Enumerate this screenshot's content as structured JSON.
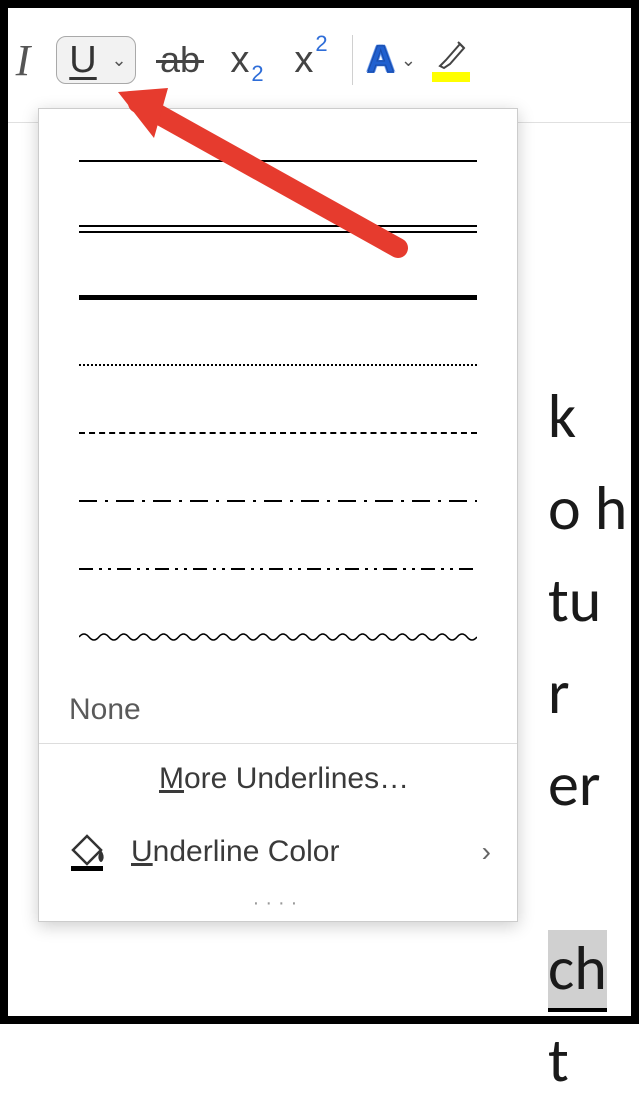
{
  "toolbar": {
    "italic_label": "I",
    "underline_label": "U",
    "strike_label": "ab",
    "subscript_x": "x",
    "subscript_n": "2",
    "superscript_x": "x",
    "superscript_n": "2",
    "font_color_label": "A"
  },
  "dropdown": {
    "none_label": "None",
    "more_prefix": "M",
    "more_rest": "ore Underlines…",
    "color_prefix": "U",
    "color_rest": "nderline Color",
    "submenu_glyph": "›",
    "handle": "····"
  },
  "document": {
    "l1": "k",
    "l2": "o h",
    "l3": "tu",
    "l4": "r",
    "l5": "er",
    "sel": "ch",
    "l7": "t "
  }
}
